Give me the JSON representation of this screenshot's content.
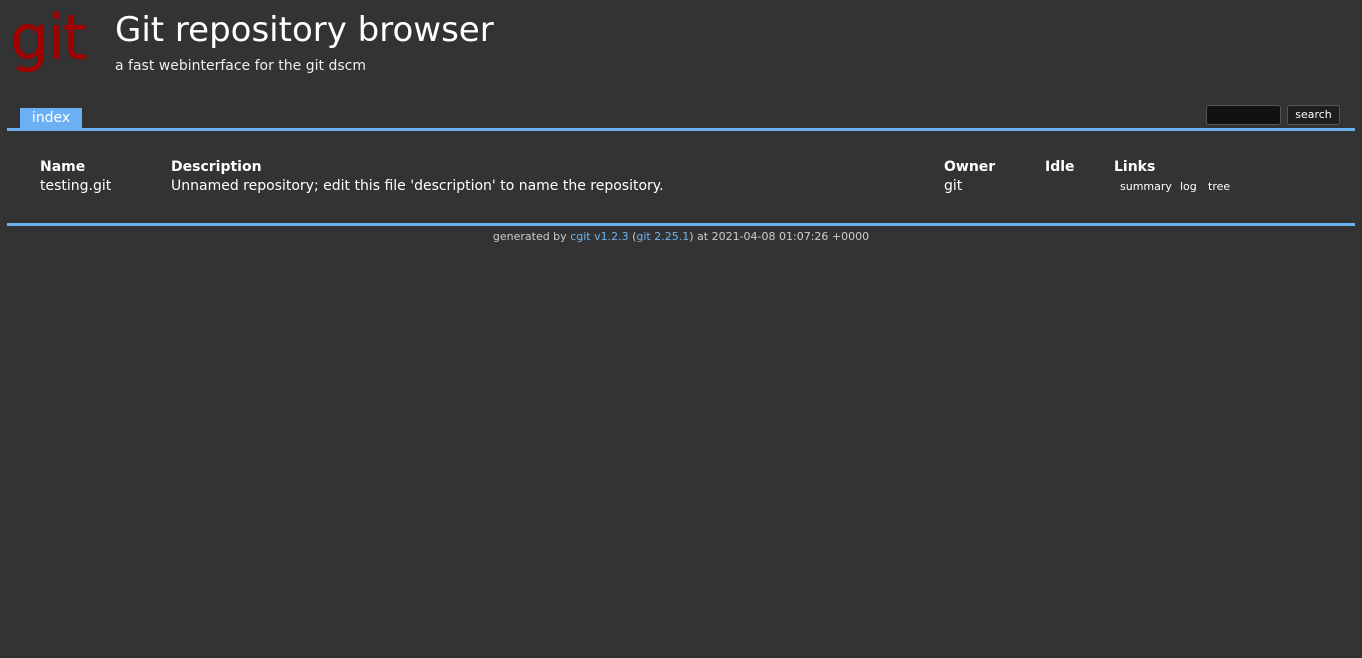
{
  "header": {
    "logo_text": "git",
    "title": "Git repository browser",
    "subtitle": "a fast webinterface for the git dscm"
  },
  "tabs": [
    {
      "label": "index",
      "active": true
    }
  ],
  "search": {
    "value": "",
    "button_label": "search"
  },
  "repo_table": {
    "columns": [
      "Name",
      "Description",
      "Owner",
      "Idle",
      "Links"
    ],
    "rows": [
      {
        "name": "testing.git",
        "description": "Unnamed repository; edit this file 'description' to name the repository.",
        "owner": "git",
        "idle": "",
        "links": [
          "summary",
          "log",
          "tree"
        ]
      }
    ]
  },
  "footer": {
    "prefix": "generated by ",
    "cgit_link": "cgit v1.2.3",
    "open_paren": " (",
    "git_link": "git 2.25.1",
    "suffix": ") at 2021-04-08 01:07:26 +0000"
  },
  "colors": {
    "background": "#333333",
    "accent": "#6cb0f4",
    "logo": "#a00000"
  }
}
